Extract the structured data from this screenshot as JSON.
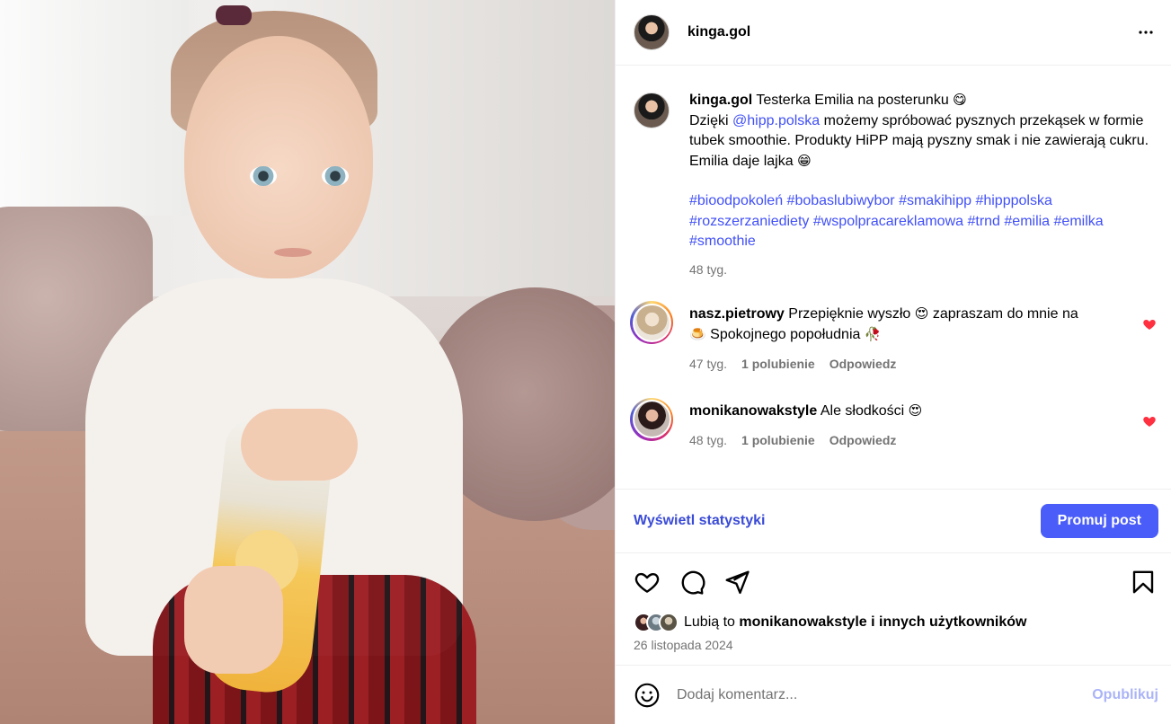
{
  "post": {
    "username": "kinga.gol",
    "more_label": "•••"
  },
  "caption": {
    "username": "kinga.gol",
    "line1": "Testerka Emilia na posterunku",
    "emoji1": "😋",
    "thanks": "Dzięki",
    "mention": "@hipp.polska",
    "line2": "możemy spróbować pysznych przekąsek w formie tubek smoothie. Produkty HiPP mają pyszny smak i nie zawierają cukru. Emilia daje lajka",
    "emoji2": "😁",
    "hashtags": "#bioodpokoleń #bobaslubiwybor #smakihipp #hipppolska #rozszerzaniediety #wspolpracareklamowa #trnd #emilia #emilka #smoothie",
    "time": "48 tyg."
  },
  "comments": [
    {
      "username": "nasz.pietrowy",
      "text_a": "Przepięknie wyszło",
      "emoji_a": "😍",
      "text_b": "zapraszam do mnie na",
      "emoji_b": "🍮",
      "text_c": "Spokojnego popołudnia",
      "emoji_c": "🥀",
      "time": "47 tyg.",
      "likes": "1 polubienie",
      "reply": "Odpowiedz"
    },
    {
      "username": "monikanowakstyle",
      "text_a": "Ale słodkości",
      "emoji_a": "😍",
      "time": "48 tyg.",
      "likes": "1 polubienie",
      "reply": "Odpowiedz"
    }
  ],
  "stats": {
    "view_label": "Wyświetl statystyki",
    "promote_label": "Promuj post"
  },
  "likes_line": {
    "prefix": "Lubią to",
    "user": "monikanowakstyle",
    "suffix": "i innych użytkowników"
  },
  "date": "26 listopada 2024",
  "comment_box": {
    "placeholder": "Dodaj komentarz...",
    "publish_label": "Opublikuj"
  },
  "colors": {
    "accent": "#4a5df9",
    "link": "#4150f7",
    "like_red": "#ff3040",
    "muted": "#737373"
  }
}
